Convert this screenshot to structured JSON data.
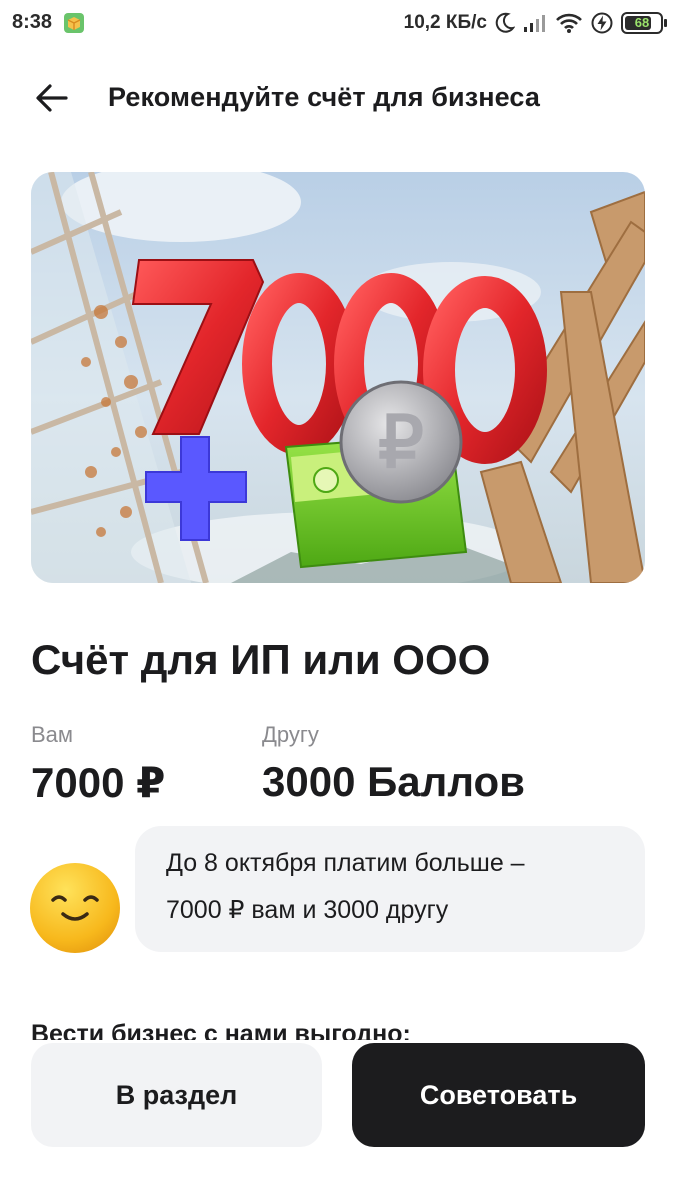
{
  "status_bar": {
    "time": "8:38",
    "net_speed": "10,2 КБ/с",
    "battery_level": "68",
    "icons": [
      "app-notification-icon",
      "moon-icon",
      "signal-icon",
      "wifi-icon",
      "charging-icon",
      "battery-icon"
    ]
  },
  "header": {
    "back_icon": "arrow-left-icon",
    "title": "Рекомендуйте счёт для бизнеса"
  },
  "banner": {
    "amount": "7000",
    "currency_symbol": "₽",
    "icons": [
      "plus-icon",
      "wallet-icon",
      "ruble-coin-icon"
    ]
  },
  "product": {
    "title": "Счёт для ИП или ООО",
    "you_label": "Вам",
    "you_value": "7000 ₽",
    "friend_label": "Другу",
    "friend_value": "3000 Баллов"
  },
  "promo": {
    "avatar_icon": "smiley-face-icon",
    "line1": "До 8 октября платим больше –",
    "line2": "7000 ₽ вам и 3000 другу"
  },
  "section": {
    "heading": "Вести бизнес с нами выгодно:"
  },
  "actions": {
    "secondary_label": "В раздел",
    "primary_label": "Советовать"
  },
  "colors": {
    "primary_button": "#1c1c1e",
    "secondary_button": "#f2f3f5",
    "banner_numbers": "#e3262b",
    "plus": "#5a58ff",
    "wallet": "#6cc51b"
  }
}
